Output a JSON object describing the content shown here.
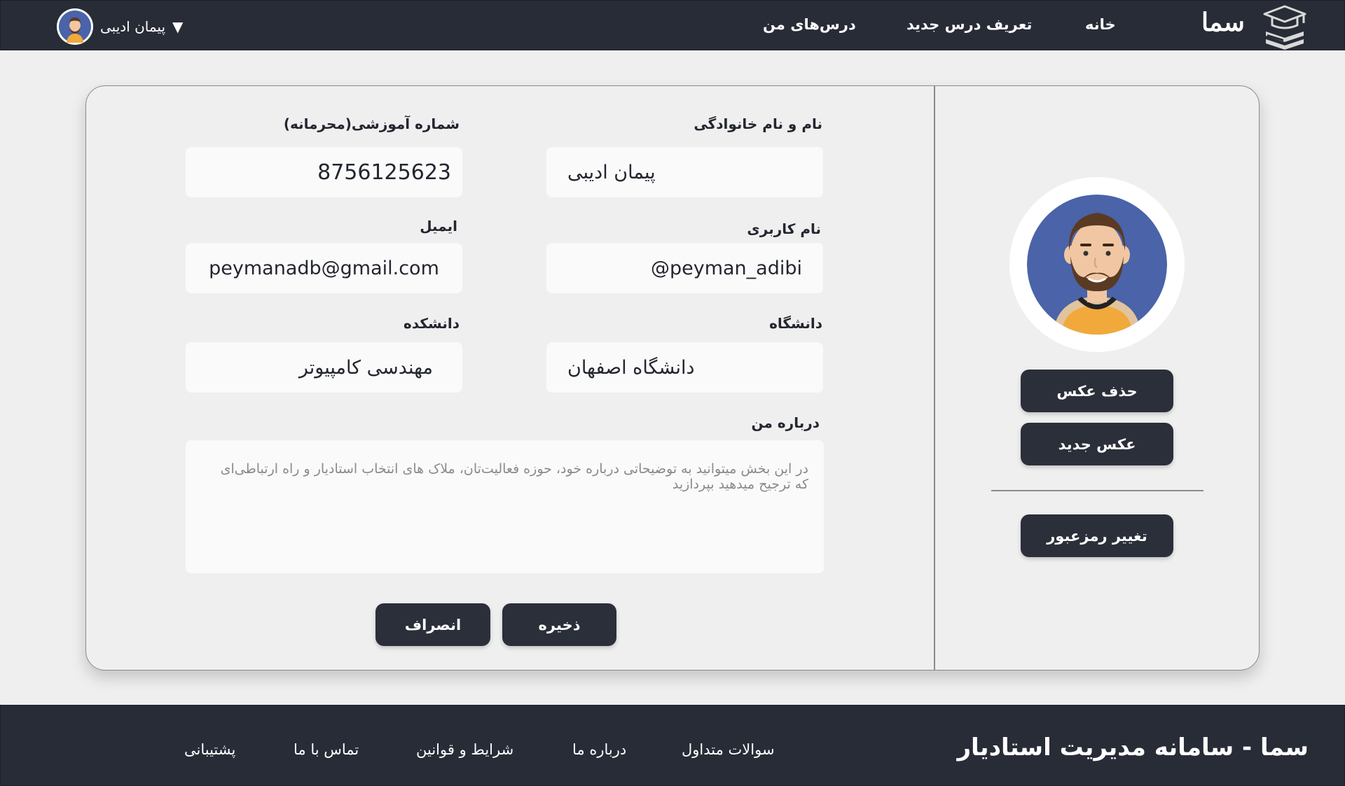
{
  "navbar": {
    "logo_text": "سما",
    "logo_icon": "graduation-cap-books-icon",
    "links": {
      "home": "خانه",
      "new_course": "تعریف درس جدید",
      "my_courses": "درس‌های من"
    },
    "user": {
      "name": "پیمان ادیبی",
      "caret": "▼",
      "avatar_icon": "user-avatar-icon"
    }
  },
  "form": {
    "full_name": {
      "label": "نام و نام خانوادگی",
      "value": "پیمان ادیبی"
    },
    "student_id": {
      "label": "شماره آموزشی(محرمانه)",
      "value": "8756125623"
    },
    "username": {
      "label": "نام کاربری",
      "value": "@peyman_adibi"
    },
    "email": {
      "label": "ایمیل",
      "value": "peymanadb@gmail.com"
    },
    "university": {
      "label": "دانشگاه",
      "value": "دانشگاه اصفهان"
    },
    "faculty": {
      "label": "دانشکده",
      "value": "مهندسی کامپیوتر"
    },
    "about": {
      "label": "درباره من",
      "placeholder": "در این بخش میتوانید به توضیحاتی درباره خود، حوزه فعالیت‌تان، ملاک های انتخاب استادیار و راه ارتباطی‌ای که ترجیح میدهید بپردازید"
    },
    "save_label": "ذخیره",
    "cancel_label": "انصراف"
  },
  "sidebar": {
    "delete_photo_label": "حذف عکس",
    "new_photo_label": "عکس جدید",
    "change_password_label": "تغییر رمزعبور"
  },
  "footer": {
    "title": "سما - سامانه مدیریت استادیار",
    "links": {
      "faq": "سوالات متداول",
      "about": "درباره ما",
      "terms": "شرایط و قوانین",
      "contact": "تماس با ما",
      "support": "پشتیبانی"
    }
  },
  "colors": {
    "navbar_bg": "#282c37",
    "page_bg": "#efefef",
    "button_bg": "#2b2f39",
    "field_bg": "#fafafa",
    "avatar_bg": "#4a63a9",
    "shirt": "#f2a93b"
  }
}
